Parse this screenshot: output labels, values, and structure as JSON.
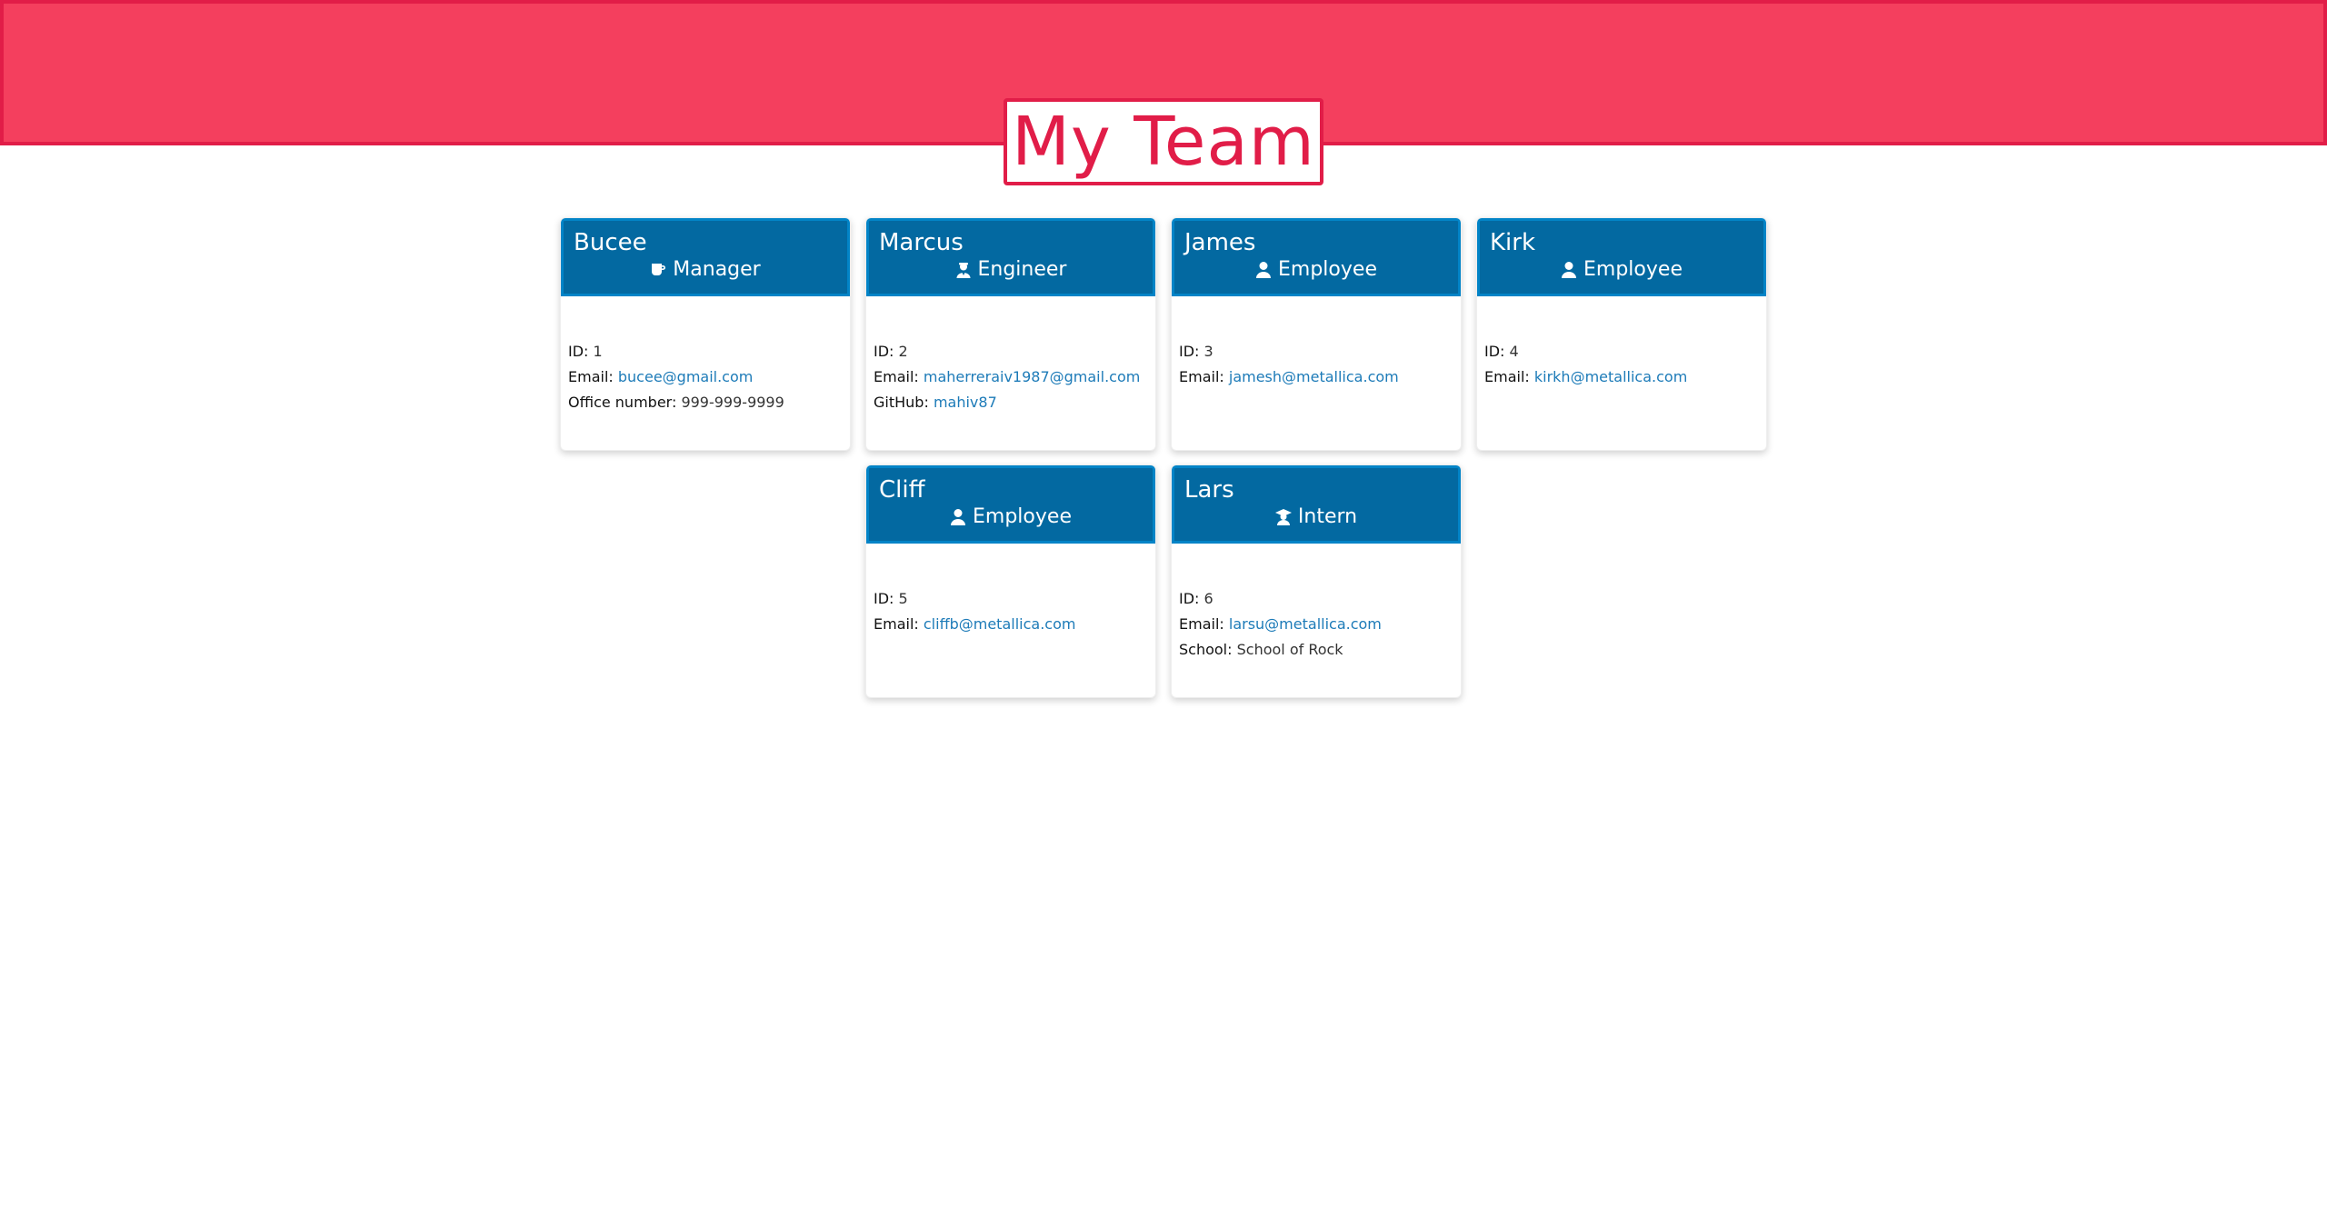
{
  "page": {
    "title": "My Team"
  },
  "colors": {
    "banner": "#f43f5e",
    "banner_border": "#e11d48",
    "card_header": "#0369a1",
    "link": "#1d7bb8"
  },
  "labels": {
    "id": "ID:",
    "email": "Email:",
    "office": "Office number:",
    "github": "GitHub:",
    "school": "School:"
  },
  "team": [
    {
      "name": "Bucee",
      "role": "Manager",
      "icon": "mug-icon",
      "id": "1",
      "email": "bucee@gmail.com",
      "office_number": "999-999-9999"
    },
    {
      "name": "Marcus",
      "role": "Engineer",
      "icon": "engineer-icon",
      "id": "2",
      "email": "maherreraiv1987@gmail.com",
      "github": "mahiv87"
    },
    {
      "name": "James",
      "role": "Employee",
      "icon": "user-icon",
      "id": "3",
      "email": "jamesh@metallica.com"
    },
    {
      "name": "Kirk",
      "role": "Employee",
      "icon": "user-icon",
      "id": "4",
      "email": "kirkh@metallica.com"
    },
    {
      "name": "Cliff",
      "role": "Employee",
      "icon": "user-icon",
      "id": "5",
      "email": "cliffb@metallica.com"
    },
    {
      "name": "Lars",
      "role": "Intern",
      "icon": "graduate-icon",
      "id": "6",
      "email": "larsu@metallica.com",
      "school": "School of Rock"
    }
  ]
}
